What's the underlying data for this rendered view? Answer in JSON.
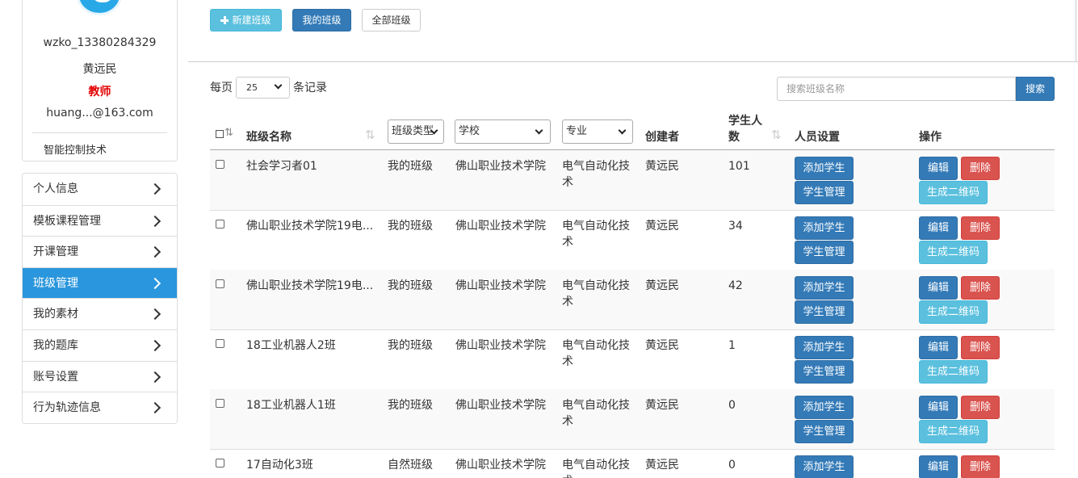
{
  "profile": {
    "username": "wzko_13380284329",
    "name": "黄远民",
    "role": "教师",
    "email": "huang...@163.com",
    "department": "智能控制技术"
  },
  "menu": [
    {
      "label": "个人信息",
      "active": false
    },
    {
      "label": "模板课程管理",
      "active": false
    },
    {
      "label": "开课管理",
      "active": false
    },
    {
      "label": "班级管理",
      "active": true
    },
    {
      "label": "我的素材",
      "active": false
    },
    {
      "label": "我的题库",
      "active": false
    },
    {
      "label": "账号设置",
      "active": false
    },
    {
      "label": "行为轨迹信息",
      "active": false
    }
  ],
  "toolbar": {
    "new_label": "新建班级",
    "mine_label": "我的班级",
    "all_label": "全部班级"
  },
  "length_menu": {
    "prefix": "每页",
    "value": "25",
    "suffix": "条记录"
  },
  "search": {
    "placeholder": "搜索班级名称",
    "button": "搜索"
  },
  "columns": {
    "name": "班级名称",
    "type": "班级类型",
    "school": "学校",
    "major": "专业",
    "creator": "创建者",
    "count_line1": "学生人",
    "count_line2": "数",
    "people": "人员设置",
    "ops": "操作"
  },
  "row_buttons": {
    "add": "添加学生",
    "manage": "学生管理",
    "edit": "编辑",
    "delete": "删除",
    "qr": "生成二维码"
  },
  "rows": [
    {
      "name": "社会学习者01",
      "type": "我的班级",
      "school": "佛山职业技术学院",
      "major": "电气自动化技术",
      "creator": "黄远民",
      "count": "101"
    },
    {
      "name": "佛山职业技术学院19电...",
      "type": "我的班级",
      "school": "佛山职业技术学院",
      "major": "电气自动化技术",
      "creator": "黄远民",
      "count": "34"
    },
    {
      "name": "佛山职业技术学院19电...",
      "type": "我的班级",
      "school": "佛山职业技术学院",
      "major": "电气自动化技术",
      "creator": "黄远民",
      "count": "42"
    },
    {
      "name": "18工业机器人2班",
      "type": "我的班级",
      "school": "佛山职业技术学院",
      "major": "电气自动化技术",
      "creator": "黄远民",
      "count": "1"
    },
    {
      "name": "18工业机器人1班",
      "type": "我的班级",
      "school": "佛山职业技术学院",
      "major": "电气自动化技术",
      "creator": "黄远民",
      "count": "0"
    },
    {
      "name": "17自动化3班",
      "type": "自然班级",
      "school": "佛山职业技术学院",
      "major": "电气自动化技术",
      "creator": "黄远民",
      "count": "0"
    }
  ],
  "colors": {
    "primary": "#337ab7",
    "info": "#5bc0de",
    "danger": "#d9534f",
    "menu_active": "#2a96dd",
    "role_red": "#e30000"
  }
}
